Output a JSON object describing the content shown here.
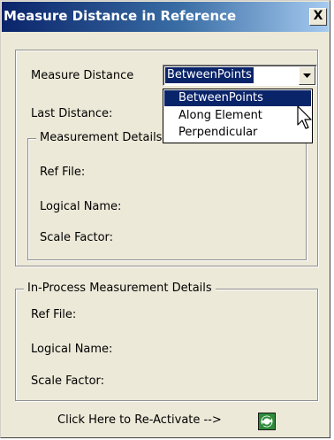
{
  "window": {
    "title": "Measure Distance in Reference",
    "close_label": "X"
  },
  "measure": {
    "label": "Measure Distance",
    "selected": "BetweenPoints",
    "options": [
      "BetweenPoints",
      "Along Element",
      "Perpendicular"
    ]
  },
  "last_distance_label": "Last Distance:",
  "measurement_details": {
    "legend": "Measurement Details",
    "ref_file_label": "Ref File:",
    "logical_name_label": "Logical Name:",
    "scale_factor_label": "Scale Factor:"
  },
  "in_process_details": {
    "legend": "In-Process Measurement Details",
    "ref_file_label": "Ref File:",
    "logical_name_label": "Logical Name:",
    "scale_factor_label": "Scale Factor:"
  },
  "reactivate": {
    "label": "Click Here to Re-Activate -->",
    "icon": "reactivate-icon"
  },
  "colors": {
    "title_bar": "#0a246a",
    "selection": "#0a246a",
    "dialog_bg": "#ece9d8",
    "icon_green": "#2e8b3a"
  }
}
